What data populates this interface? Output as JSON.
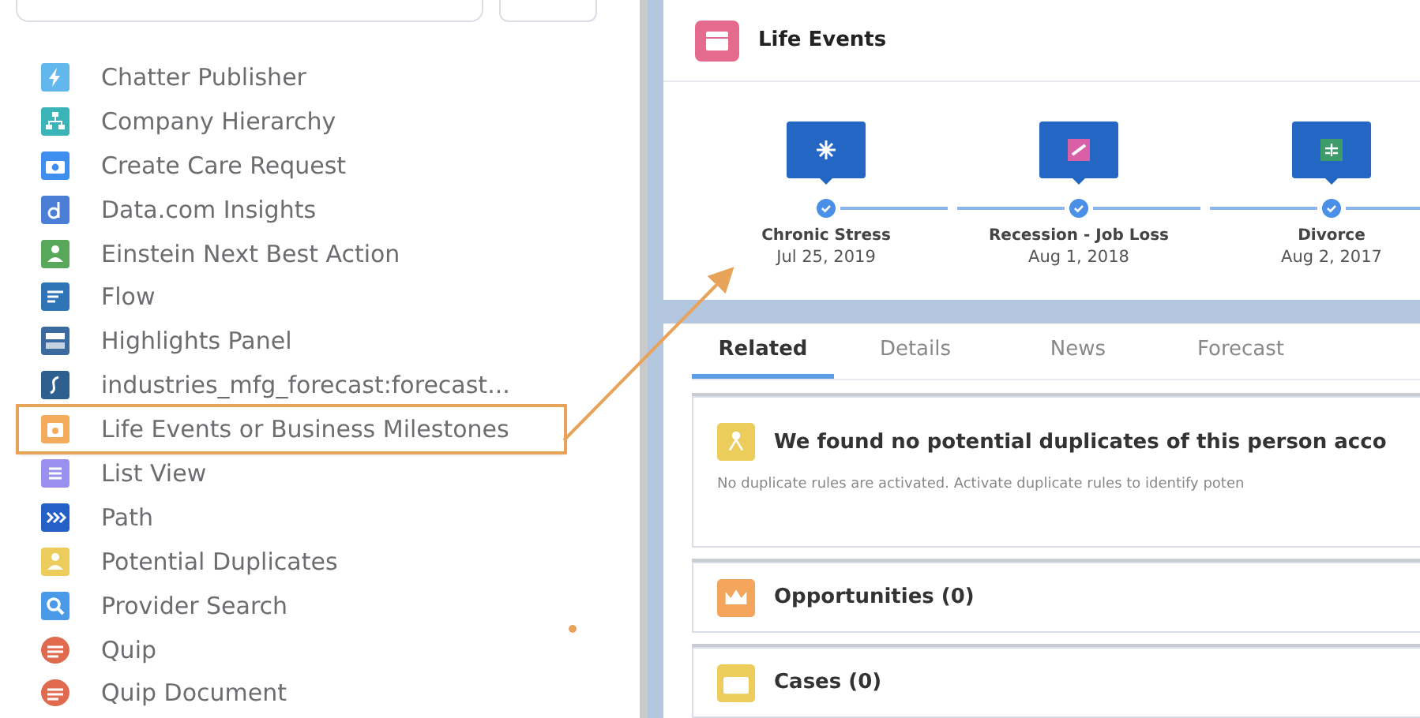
{
  "sidebar": {
    "items": [
      {
        "label": "Chatter Publisher",
        "kind": "bolt",
        "color": "#62b7ed",
        "selected": false
      },
      {
        "label": "Company Hierarchy",
        "kind": "hierarchy",
        "color": "#3bb4b8",
        "selected": false
      },
      {
        "label": "Create Care Request",
        "kind": "camera",
        "color": "#3e8eef",
        "selected": false
      },
      {
        "label": "Data.com Insights",
        "kind": "letter-d",
        "color": "#4b7fd6",
        "selected": false
      },
      {
        "label": "Einstein Next Best Action",
        "kind": "person",
        "color": "#58a85c",
        "selected": false
      },
      {
        "label": "Flow",
        "kind": "flow",
        "color": "#2f74b5",
        "selected": false
      },
      {
        "label": "Highlights Panel",
        "kind": "panel",
        "color": "#3b6a9e",
        "selected": false
      },
      {
        "label": "industries_mfg_forecast:forecast...",
        "kind": "script",
        "color": "#2e5f8f",
        "selected": false
      },
      {
        "label": "Life Events or Business Milestones",
        "kind": "calendar",
        "color": "#f4ab5c",
        "selected": true
      },
      {
        "label": "List View",
        "kind": "list",
        "color": "#9b8ff0",
        "selected": false
      },
      {
        "label": "Path",
        "kind": "chevrons",
        "color": "#2560c6",
        "selected": false
      },
      {
        "label": "Potential Duplicates",
        "kind": "person",
        "color": "#eccc5a",
        "selected": false
      },
      {
        "label": "Provider Search",
        "kind": "search",
        "color": "#4a9ae8",
        "selected": false
      },
      {
        "label": "Quip",
        "kind": "quip",
        "color": "#e06a4e",
        "selected": false
      },
      {
        "label": "Quip Document",
        "kind": "quip",
        "color": "#e06a4e",
        "selected": false
      }
    ]
  },
  "life_events": {
    "title": "Life Events",
    "events": [
      {
        "title": "Chronic Stress",
        "date": "Jul 25, 2019",
        "kind": "stress"
      },
      {
        "title": "Recession - Job Loss",
        "date": "Aug 1, 2018",
        "kind": "job-loss"
      },
      {
        "title": "Divorce",
        "date": "Aug 2, 2017",
        "kind": "divorce"
      }
    ]
  },
  "tabs": [
    {
      "label": "Related",
      "selected": true
    },
    {
      "label": "Details",
      "selected": false
    },
    {
      "label": "News",
      "selected": false
    },
    {
      "label": "Forecast",
      "selected": false
    }
  ],
  "cards": [
    {
      "title": "We found no potential duplicates of this person acco",
      "message": "No duplicate rules are activated. Activate duplicate rules to identify poten",
      "kind": "duplicates"
    },
    {
      "title": "Opportunities (0)",
      "kind": "opportunities"
    },
    {
      "title": "Cases (0)",
      "kind": "cases"
    }
  ]
}
